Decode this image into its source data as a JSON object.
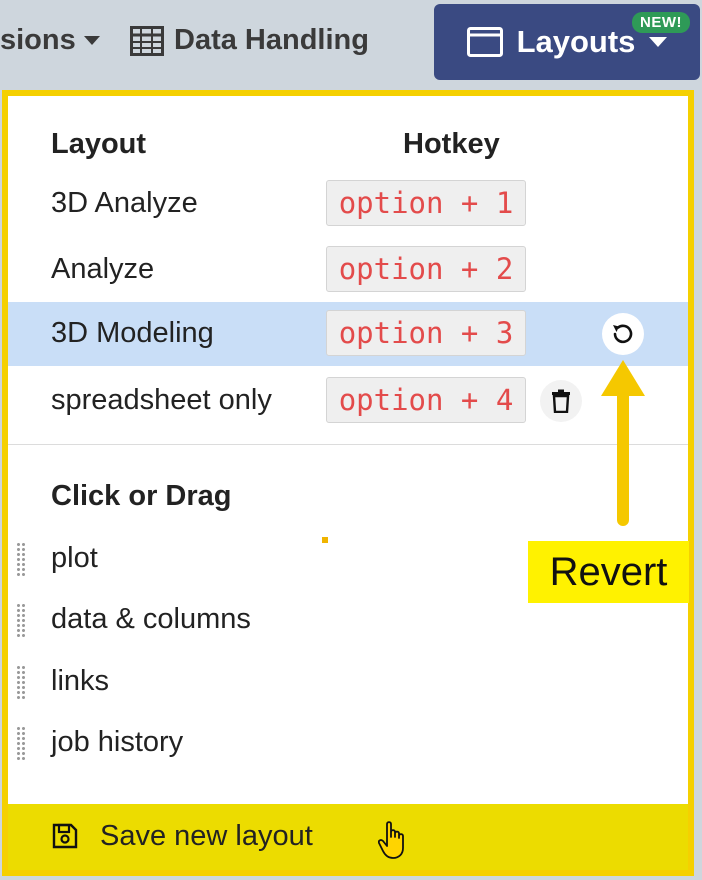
{
  "topbar": {
    "extensions_label": "sions",
    "data_handling_label": "Data Handling",
    "layouts_label": "Layouts",
    "new_badge": "NEW!"
  },
  "panel": {
    "header_layout": "Layout",
    "header_hotkey": "Hotkey",
    "layouts": [
      {
        "name": "3D Analyze",
        "hotkey": "option + 1"
      },
      {
        "name": "Analyze",
        "hotkey": "option + 2"
      },
      {
        "name": "3D Modeling",
        "hotkey": "option + 3"
      },
      {
        "name": "spreadsheet only",
        "hotkey": "option + 4"
      }
    ],
    "click_drag_header": "Click or Drag",
    "drag_items": [
      "plot",
      "data & columns",
      "links",
      "job history"
    ],
    "save_label": "Save new layout"
  },
  "annotation": {
    "revert_label": "Revert",
    "highlight_color": "#f5d000"
  },
  "colors": {
    "layouts_button": "#3a4a82",
    "new_badge": "#2e9a57",
    "active_row": "#c9def7",
    "hotkey_text": "#e34b4b"
  }
}
